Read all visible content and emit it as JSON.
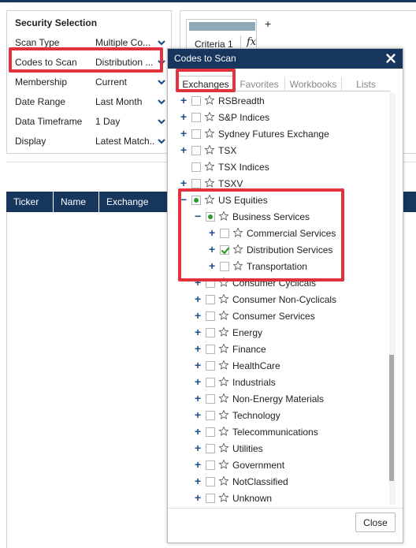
{
  "security_selection": {
    "title": "Security Selection",
    "rows": [
      {
        "label": "Scan Type",
        "value": "Multiple Co..."
      },
      {
        "label": "Codes to Scan",
        "value": "Distribution ..."
      },
      {
        "label": "Membership",
        "value": "Current"
      },
      {
        "label": "Date Range",
        "value": "Last Month"
      },
      {
        "label": "Data Timeframe",
        "value": "1 Day"
      },
      {
        "label": "Display",
        "value": "Latest Match..."
      }
    ]
  },
  "criteria": {
    "tab_label": "Criteria 1",
    "fx_label": "fx",
    "add_label": "+"
  },
  "table": {
    "columns": [
      "Ticker",
      "Name",
      "Exchange"
    ]
  },
  "dialog": {
    "title": "Codes to Scan",
    "tabs": [
      "Exchanges",
      "Favorites",
      "Workbooks",
      "Lists"
    ],
    "active_tab": "Exchanges",
    "close_button_label": "Close",
    "tree": [
      {
        "label": "RSBreadth",
        "level": 0,
        "expander": "+",
        "check": "none"
      },
      {
        "label": "S&P Indices",
        "level": 0,
        "expander": "+",
        "check": "none"
      },
      {
        "label": "Sydney Futures Exchange",
        "level": 0,
        "expander": "+",
        "check": "none"
      },
      {
        "label": "TSX",
        "level": 0,
        "expander": "+",
        "check": "none"
      },
      {
        "label": "TSX Indices",
        "level": 0,
        "expander": "",
        "check": "none"
      },
      {
        "label": "TSXV",
        "level": 0,
        "expander": "+",
        "check": "none"
      },
      {
        "label": "US Equities",
        "level": 0,
        "expander": "−",
        "check": "partial"
      },
      {
        "label": "Business Services",
        "level": 1,
        "expander": "−",
        "check": "partial"
      },
      {
        "label": "Commercial Services",
        "level": 2,
        "expander": "+",
        "check": "none"
      },
      {
        "label": "Distribution Services",
        "level": 2,
        "expander": "+",
        "check": "checked"
      },
      {
        "label": "Transportation",
        "level": 2,
        "expander": "+",
        "check": "none"
      },
      {
        "label": "Consumer Cyclicals",
        "level": 1,
        "expander": "+",
        "check": "none"
      },
      {
        "label": "Consumer Non-Cyclicals",
        "level": 1,
        "expander": "+",
        "check": "none"
      },
      {
        "label": "Consumer Services",
        "level": 1,
        "expander": "+",
        "check": "none"
      },
      {
        "label": "Energy",
        "level": 1,
        "expander": "+",
        "check": "none"
      },
      {
        "label": "Finance",
        "level": 1,
        "expander": "+",
        "check": "none"
      },
      {
        "label": "HealthCare",
        "level": 1,
        "expander": "+",
        "check": "none"
      },
      {
        "label": "Industrials",
        "level": 1,
        "expander": "+",
        "check": "none"
      },
      {
        "label": "Non-Energy Materials",
        "level": 1,
        "expander": "+",
        "check": "none"
      },
      {
        "label": "Technology",
        "level": 1,
        "expander": "+",
        "check": "none"
      },
      {
        "label": "Telecommunications",
        "level": 1,
        "expander": "+",
        "check": "none"
      },
      {
        "label": "Utilities",
        "level": 1,
        "expander": "+",
        "check": "none"
      },
      {
        "label": "Government",
        "level": 1,
        "expander": "+",
        "check": "none"
      },
      {
        "label": "NotClassified",
        "level": 1,
        "expander": "+",
        "check": "none"
      },
      {
        "label": "Unknown",
        "level": 1,
        "expander": "+",
        "check": "none"
      }
    ]
  },
  "icons": {
    "dropdown": "chevron-down-icon",
    "close": "close-icon",
    "favorite": "star-icon",
    "expand": "plus-icon",
    "collapse": "minus-icon"
  },
  "colors": {
    "header_navy": "#17365d",
    "accent_blue": "#1b4f8a",
    "check_green": "#2c9b2c",
    "highlight_red": "#e2323c"
  }
}
